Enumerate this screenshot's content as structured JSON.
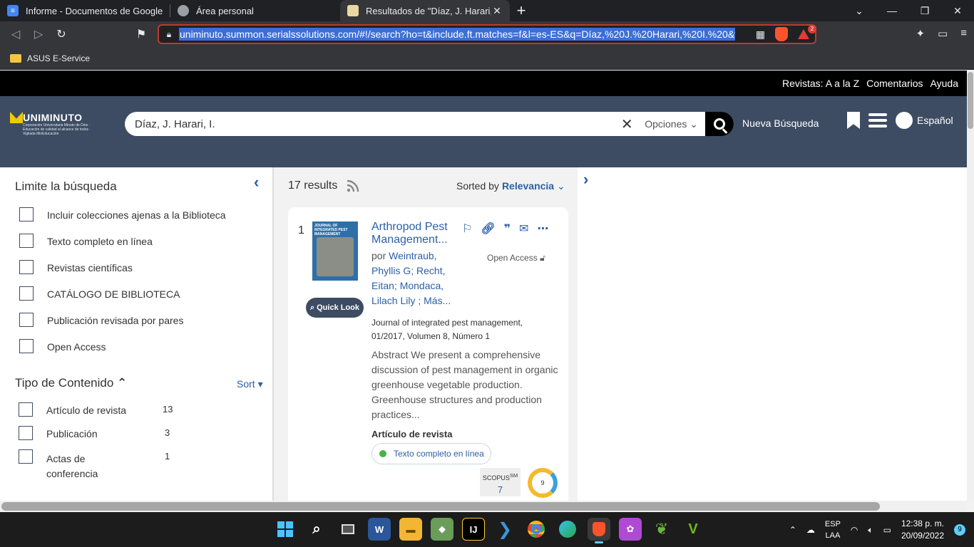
{
  "browser": {
    "tabs": [
      {
        "title": "Informe - Documentos de Google",
        "active": false
      },
      {
        "title": "Área personal",
        "active": false
      },
      {
        "title": "Resultados de \"Díaz, J. Harari, I. \"",
        "active": true
      }
    ],
    "new_tab": "+",
    "url": "uniminuto.summon.serialssolutions.com/#!/search?ho=t&include.ft.matches=f&l=es-ES&q=Díaz,%20J.%20Harari,%20I.%20&%",
    "rewards_badge": "2",
    "bookmarks": [
      {
        "label": "ASUS E-Service"
      }
    ]
  },
  "topnav": {
    "links": [
      "Revistas: A a la Z",
      "Comentarios",
      "Ayuda"
    ]
  },
  "header": {
    "logo_text": "UNIMINUTO",
    "logo_sub": "Corporación Universitaria Minuto de Dios · Educación de calidad al alcance de todos · Vigilada MinEducación",
    "search_value": "Díaz, J. Harari, I.",
    "options_label": "Opciones",
    "new_search": "Nueva Búsqueda",
    "language": "Español"
  },
  "sidebar": {
    "title": "Limite la búsqueda",
    "filters": [
      "Incluir colecciones ajenas a la Biblioteca",
      "Texto completo en línea",
      "Revistas científicas",
      "CATÁLOGO DE BIBLIOTECA",
      "Publicación revisada por pares",
      "Open Access"
    ],
    "content_type": {
      "title": "Tipo de Contenido",
      "sort_label": "Sort",
      "items": [
        {
          "label": "Artículo de revista",
          "count": "13"
        },
        {
          "label": "Publicación",
          "count": "3"
        },
        {
          "label": "Actas de conferencia",
          "count": "1"
        }
      ]
    }
  },
  "results": {
    "count_text": "17 results",
    "sorted_by": "Sorted by",
    "sort_value": "Relevancia",
    "items": [
      {
        "number": "1",
        "cover_title": "JOURNAL OF INTEGRATED PEST MANAGEMENT",
        "quick_look": "Quick Look",
        "title": "Arthropod Pest Management...",
        "authors_prefix": "por",
        "authors": "Weintraub, Phyllis G; Recht, Eitan; Mondaca, Lilach Lily ; Más...",
        "open_access": "Open Access",
        "journal": "Journal of integrated pest management, 01/2017, Volumen 8, Número 1",
        "abstract": "Abstract We present a comprehensive discussion of pest management in organic greenhouse vegetable production. Greenhouse structures and production practices...",
        "content_type": "Artículo de revista",
        "fulltext": "Texto completo en línea",
        "scopus_label": "SCOPUS",
        "scopus_sup": "SM",
        "scopus_value": "7",
        "altmetric": "9"
      }
    ]
  },
  "taskbar": {
    "lang_top": "ESP",
    "lang_bottom": "LAA",
    "time": "12:38 p. m.",
    "date": "20/09/2022",
    "notifications": "9"
  }
}
